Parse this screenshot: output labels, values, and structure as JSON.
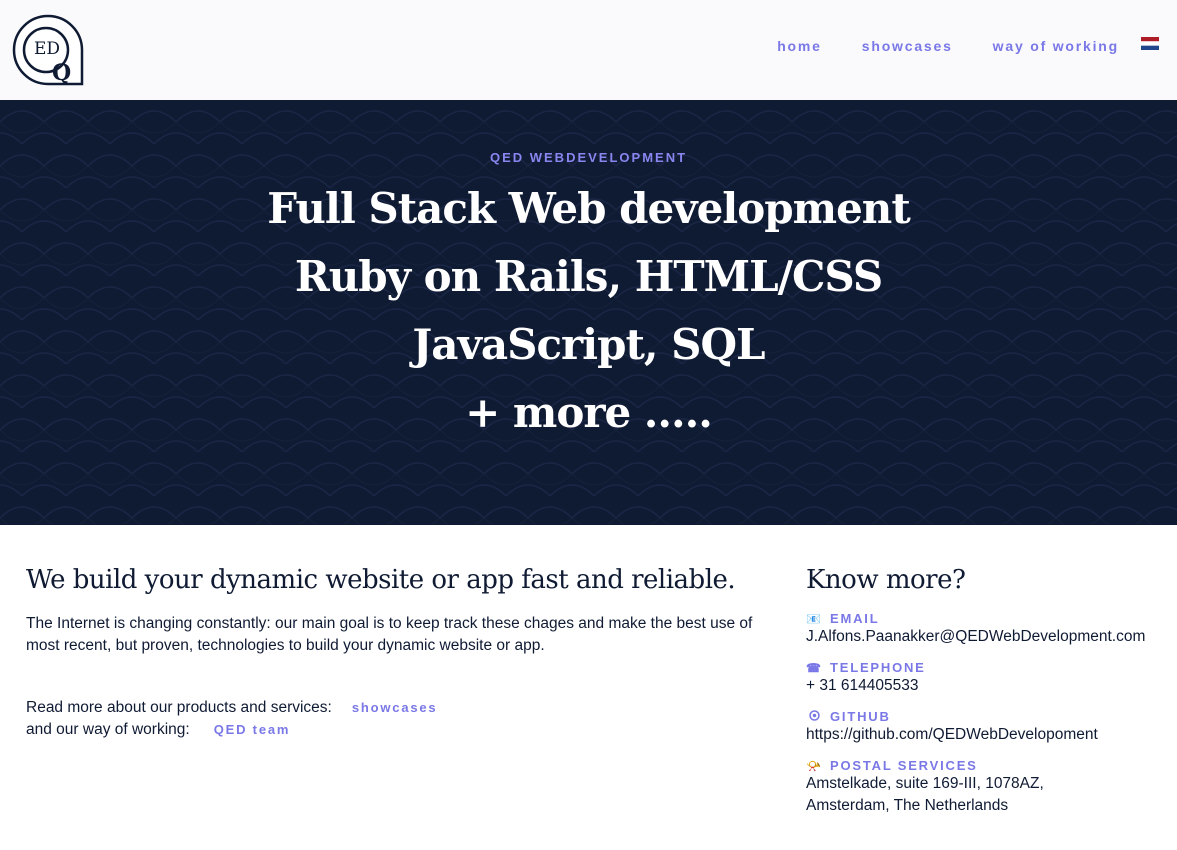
{
  "logo": {
    "text": "ED",
    "letter": "Q"
  },
  "nav": {
    "items": [
      {
        "label": "home"
      },
      {
        "label": "showcases"
      },
      {
        "label": "way of working"
      }
    ]
  },
  "hero": {
    "eyebrow": "QED WEBDEVELOPMENT",
    "lines": [
      "Full Stack Web development",
      "Ruby on Rails, HTML/CSS",
      "JavaScript, SQL",
      "+ more ....."
    ]
  },
  "main": {
    "title": "We build your dynamic website or app fast and reliable.",
    "intro": "The Internet is changing constantly: our main goal is to keep track these chages and make the best use of most recent, but proven, technologies to build your dynamic website or app.",
    "readmore_text": "Read more about our products and services:",
    "readmore_link": "showcases",
    "working_text": "and our way of working:",
    "working_link": "QED team"
  },
  "contact": {
    "title": "Know more?",
    "items": [
      {
        "icon": "email-icon",
        "glyph": "📧",
        "label": "EMAIL",
        "value": "J.Alfons.Paanakker@QEDWebDevelopment.com"
      },
      {
        "icon": "telephone-icon",
        "glyph": "☎",
        "label": "TELEPHONE",
        "value": "+ 31 614405533"
      },
      {
        "icon": "github-icon",
        "glyph": "⚙",
        "label": "GITHUB",
        "value": "https://github.com/QEDWebDevelopoment"
      },
      {
        "icon": "postal-horn-icon",
        "glyph": "📯",
        "label": "POSTAL SERVICES",
        "value": "Amstelkade, suite 169-III, 1078AZ,",
        "value2": "Amsterdam, The Netherlands"
      }
    ]
  },
  "colors": {
    "navy": "#0f1a33",
    "accent": "#7a78e6"
  }
}
